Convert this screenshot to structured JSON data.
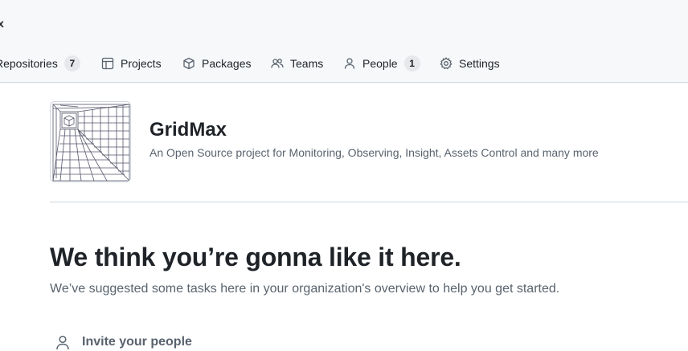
{
  "header": {
    "org_fragment": "x"
  },
  "nav": {
    "items": [
      {
        "label": "Repositories",
        "icon": "repo-icon",
        "count": "7"
      },
      {
        "label": "Projects",
        "icon": "table-icon"
      },
      {
        "label": "Packages",
        "icon": "package-icon"
      },
      {
        "label": "Teams",
        "icon": "people-icon"
      },
      {
        "label": "People",
        "icon": "person-icon",
        "count": "1"
      },
      {
        "label": "Settings",
        "icon": "gear-icon"
      }
    ]
  },
  "org": {
    "name": "GridMax",
    "description": "An Open Source project for Monitoring, Observing, Insight, Assets Control and many more"
  },
  "welcome": {
    "title": "We think you’re gonna like it here.",
    "subtitle": "We’ve suggested some tasks here in your organization's overview to help you get started."
  },
  "tasks": [
    {
      "label": "Invite your people",
      "icon": "person-icon"
    }
  ],
  "colors": {
    "header_bg": "#f6f8fa",
    "border": "#d0d7de",
    "text": "#1f2328",
    "muted": "#59636e",
    "counter_bg": "#e6e8eb"
  }
}
